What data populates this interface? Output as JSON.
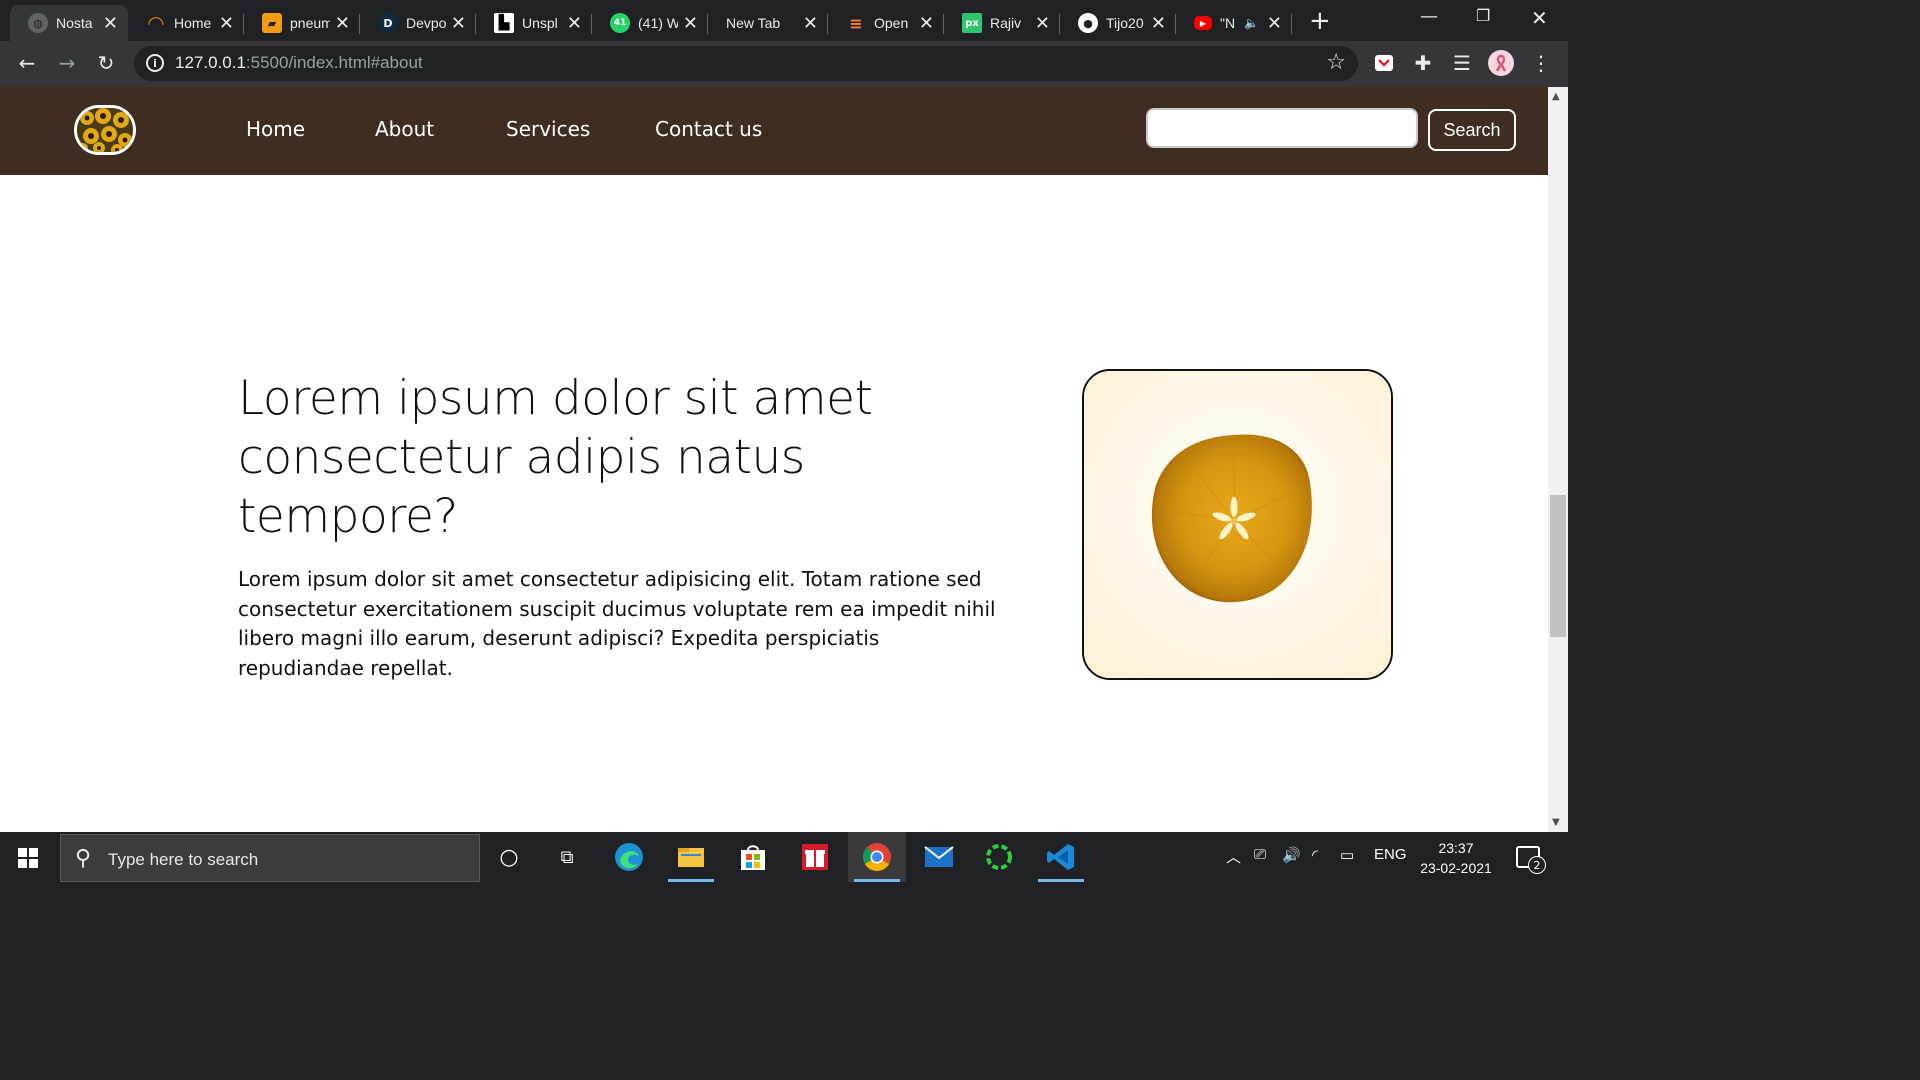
{
  "browser": {
    "tabs": [
      {
        "label": "Nosta",
        "favicon": "globe-icon",
        "color": "#5f6368",
        "glyph": "◍"
      },
      {
        "label": "Home",
        "favicon": "circle-arc-icon",
        "color": "#f57c00",
        "glyph": "◠"
      },
      {
        "label": "pneum",
        "favicon": "book-icon",
        "color": "#f39c12",
        "glyph": "▰"
      },
      {
        "label": "Devpo",
        "favicon": "devpost-icon",
        "color": "#0e2b3d",
        "glyph": "D"
      },
      {
        "label": "Unspl",
        "favicon": "unsplash-icon",
        "color": "#000000",
        "glyph": "▙"
      },
      {
        "label": "(41) W",
        "favicon": "whatsapp-icon",
        "color": "#25d366",
        "glyph": "41"
      },
      {
        "label": "New Tab",
        "favicon": "",
        "color": "",
        "glyph": ""
      },
      {
        "label": "Open",
        "favicon": "stackoverflow-icon",
        "color": "#f48024",
        "glyph": "≡"
      },
      {
        "label": "Rajiv",
        "favicon": "pixabay-icon",
        "color": "#2ec66d",
        "glyph": "px"
      },
      {
        "label": "Tijo20",
        "favicon": "github-icon",
        "color": "#ffffff",
        "glyph": "●"
      },
      {
        "label": "\"N",
        "favicon": "youtube-icon",
        "color": "#ff0000",
        "glyph": "▶"
      }
    ],
    "url_host": "127.0.0.1",
    "url_rest": ":5500/index.html#about"
  },
  "site": {
    "nav": [
      "Home",
      "About",
      "Services",
      "Contact us"
    ],
    "search_button": "Search",
    "search_placeholder": "",
    "about": {
      "title": "Lorem ipsum dolor sit amet consectetur adipis natus tempore?",
      "text": "Lorem ipsum dolor sit amet consectetur adipisicing elit. Totam ratione sed consectetur exercitationem suscipit ducimus voluptate rem ea impedit nihil libero magni illo earum, deserunt adipisci? Expedita perspiciatis repudiandae repellat."
    }
  },
  "taskbar": {
    "search_placeholder": "Type here to search",
    "language": "ENG",
    "time": "23:37",
    "date": "23-02-2021",
    "notifications": "2"
  },
  "colors": {
    "site_nav_bg": "#3e2d20",
    "chrome_dark": "#202124",
    "chrome_toolbar": "#35363a"
  }
}
